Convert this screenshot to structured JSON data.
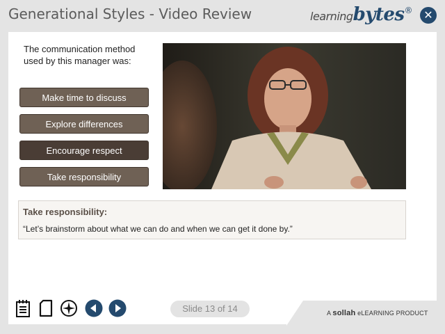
{
  "header": {
    "title": "Generational Styles - Video Review",
    "brand_part1": "learning",
    "brand_part2": "bytes",
    "brand_mark": "®",
    "close_glyph": "✕"
  },
  "question": {
    "prompt": "The communication method used by this manager was:",
    "choices": [
      {
        "label": "Make time to discuss"
      },
      {
        "label": "Explore differences"
      },
      {
        "label": "Encourage respect"
      },
      {
        "label": "Take responsibility"
      }
    ],
    "selected_index": 2
  },
  "feedback": {
    "title": "Take responsibility:",
    "text": "“Let’s brainstorm about what we can do and when we can get it done by.”"
  },
  "footer": {
    "icons": [
      "notes-icon",
      "page-icon",
      "compass-icon",
      "previous-icon",
      "next-icon"
    ],
    "slide_counter": "Slide 13 of 14",
    "product_prefix": "A ",
    "product_brand": "sollah",
    "product_suffix": " eLEARNING PRODUCT"
  },
  "colors": {
    "accent": "#244a6e",
    "button": "#6f6155",
    "button_selected": "#4a3d35"
  }
}
